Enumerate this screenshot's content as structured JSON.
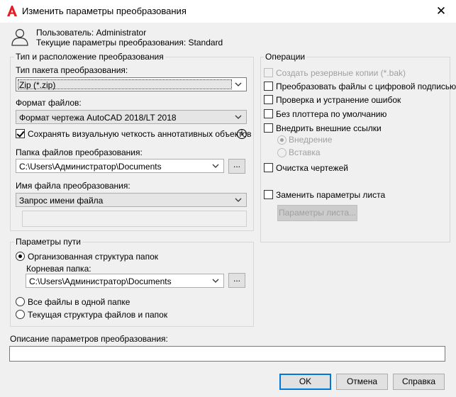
{
  "window": {
    "title": "Изменить параметры преобразования",
    "close_glyph": "✕"
  },
  "header": {
    "user_line": "Пользователь: Administrator",
    "settings_line": "Текущие параметры преобразования: Standard"
  },
  "transmittal_group": {
    "title": "Тип и расположение преобразования",
    "package_type_label": "Тип пакета преобразования:",
    "package_type_value": "Zip (*.zip)",
    "file_format_label": "Формат файлов:",
    "file_format_value": "Формат чертежа AutoCAD 2018/LT 2018",
    "keep_visual_fidelity_label": "Сохранять визуальную четкость аннотативных объектов",
    "keep_visual_fidelity_checked": true,
    "info_glyph": "i",
    "folder_label": "Папка файлов преобразования:",
    "folder_value": "C:\\Users\\Администратор\\Documents",
    "browse_label": "...",
    "filename_label": "Имя файла преобразования:",
    "filename_value": "Запрос имени файла",
    "filename_text": ""
  },
  "path_group": {
    "title": "Параметры пути",
    "organized_label": "Организованная структура папок",
    "root_folder_label": "Корневая папка:",
    "root_folder_value": "C:\\Users\\Администратор\\Documents",
    "browse_label": "...",
    "all_in_one_label": "Все файлы в одной папке",
    "keep_structure_label": "Текущая структура файлов и папок",
    "selected": "organized"
  },
  "actions_group": {
    "title": "Операции",
    "backup_label": "Создать резервные копии (*.bak)",
    "digital_signature_label": "Преобразовать файлы с цифровой подписью",
    "audit_label": "Проверка и устранение ошибок",
    "no_plotter_label": "Без плоттера по умолчанию",
    "bind_xrefs_label": "Внедрить внешние ссылки",
    "bind_label": "Внедрение",
    "insert_label": "Вставка",
    "purge_label": "Очистка чертежей",
    "replace_page_setups_label": "Заменить параметры листа",
    "page_setups_button": "Параметры листа..."
  },
  "description": {
    "label": "Описание параметров преобразования:",
    "value": ""
  },
  "buttons": {
    "ok": "OK",
    "cancel": "Отмена",
    "help": "Справка"
  },
  "colors": {
    "accent": "#0078d7",
    "brand_red": "#e31e24"
  }
}
